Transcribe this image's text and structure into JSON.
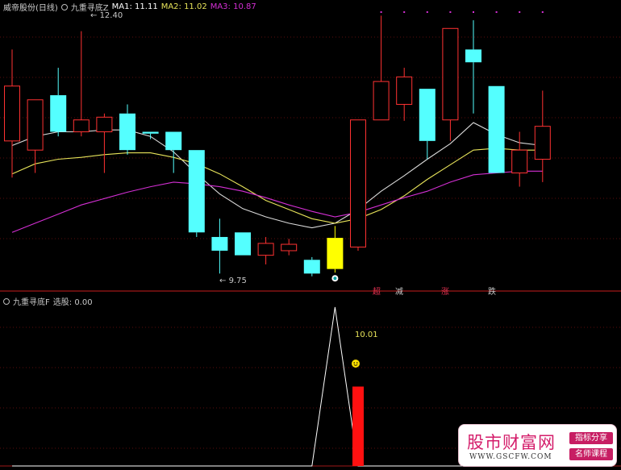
{
  "header_top": {
    "stock_name": "威帝股份(日线)",
    "indicator": "九重寻底Z",
    "ma1": "MA1: 11.11",
    "ma2": "MA2: 11.02",
    "ma3": "MA3: 10.87",
    "colors": {
      "ma1": "#ffffff",
      "ma2": "#e8e45a",
      "ma3": "#d42fd4"
    }
  },
  "header_bottom": {
    "indicator": "九重寻底F",
    "field": "选股: 0.00"
  },
  "annotations": {
    "high_label": "12.40",
    "low_label": "9.75",
    "pct_label": "10.01"
  },
  "signals": [
    {
      "text": "超",
      "color": "#e03050"
    },
    {
      "text": "减",
      "color": "#c8c8c8"
    },
    {
      "text": "涨",
      "color": "#e03050"
    },
    {
      "text": "跌",
      "color": "#c8c8c8"
    }
  ],
  "watermark": {
    "title": "股市财富网",
    "url": "WWW.GSCFW.COM",
    "tag1": "指标分享",
    "tag2": "名师课程"
  },
  "chart_data": {
    "type": "candlestick",
    "up_color": "#ff3232",
    "down_color": "#54ffff",
    "highlight_color": "#ffff00",
    "price_range": [
      9.7,
      12.6
    ],
    "candles": [
      {
        "o": 11.2,
        "h": 12.2,
        "l": 10.8,
        "c": 11.8
      },
      {
        "o": 11.1,
        "h": 11.5,
        "l": 10.85,
        "c": 11.65
      },
      {
        "o": 11.7,
        "h": 12.0,
        "l": 11.25,
        "c": 11.3
      },
      {
        "o": 11.3,
        "h": 12.4,
        "l": 11.25,
        "c": 11.43
      },
      {
        "o": 11.3,
        "h": 11.5,
        "l": 10.85,
        "c": 11.46
      },
      {
        "o": 11.5,
        "h": 11.6,
        "l": 11.05,
        "c": 11.1
      },
      {
        "o": 11.3,
        "h": 11.3,
        "l": 11.22,
        "c": 11.28
      },
      {
        "o": 11.3,
        "h": 11.3,
        "l": 10.85,
        "c": 11.1
      },
      {
        "o": 11.1,
        "h": 11.1,
        "l": 10.15,
        "c": 10.2
      },
      {
        "o": 10.15,
        "h": 10.35,
        "l": 9.75,
        "c": 10.0
      },
      {
        "o": 10.2,
        "h": 10.2,
        "l": 9.95,
        "c": 9.95
      },
      {
        "o": 9.95,
        "h": 10.15,
        "l": 9.85,
        "c": 10.08
      },
      {
        "o": 10.0,
        "h": 10.13,
        "l": 9.95,
        "c": 10.07
      },
      {
        "o": 9.9,
        "h": 9.93,
        "l": 9.72,
        "c": 9.75
      },
      {
        "o": 9.8,
        "h": 10.27,
        "l": 9.76,
        "c": 10.14,
        "highlight": true
      },
      {
        "o": 10.04,
        "h": 11.43,
        "l": 10.0,
        "c": 11.43
      },
      {
        "o": 11.43,
        "h": 12.57,
        "l": 11.43,
        "c": 11.85
      },
      {
        "o": 11.6,
        "h": 12.0,
        "l": 11.42,
        "c": 11.9
      },
      {
        "o": 11.77,
        "h": 11.77,
        "l": 11.0,
        "c": 11.2
      },
      {
        "o": 11.43,
        "h": 12.43,
        "l": 11.2,
        "c": 12.43
      },
      {
        "o": 12.2,
        "h": 12.52,
        "l": 11.5,
        "c": 12.06
      },
      {
        "o": 11.8,
        "h": 11.8,
        "l": 10.85,
        "c": 10.85
      },
      {
        "o": 10.85,
        "h": 11.3,
        "l": 10.7,
        "c": 11.1
      },
      {
        "o": 11.0,
        "h": 11.75,
        "l": 10.75,
        "c": 11.36
      }
    ],
    "ma1": [
      11.15,
      11.25,
      11.3,
      11.3,
      11.32,
      11.32,
      11.25,
      11.08,
      10.84,
      10.62,
      10.46,
      10.37,
      10.3,
      10.25,
      10.3,
      10.45,
      10.65,
      10.82,
      11.0,
      11.17,
      11.4,
      11.27,
      11.18,
      11.15
    ],
    "ma2": [
      10.84,
      10.95,
      11.0,
      11.02,
      11.05,
      11.07,
      11.07,
      11.02,
      10.95,
      10.84,
      10.7,
      10.55,
      10.45,
      10.35,
      10.3,
      10.35,
      10.45,
      10.6,
      10.78,
      10.94,
      11.1,
      11.12,
      11.1,
      11.1
    ],
    "ma3": [
      10.2,
      10.3,
      10.4,
      10.5,
      10.57,
      10.64,
      10.7,
      10.75,
      10.73,
      10.7,
      10.65,
      10.58,
      10.5,
      10.43,
      10.37,
      10.42,
      10.5,
      10.58,
      10.65,
      10.75,
      10.83,
      10.85,
      10.87,
      10.87
    ],
    "signal_line": [
      0,
      0,
      0,
      0,
      0,
      0,
      0,
      0,
      0,
      0,
      0,
      0,
      0,
      0,
      1,
      0,
      0,
      0,
      0,
      0,
      0,
      0,
      0,
      0
    ],
    "signal_bar": [
      0,
      0,
      0,
      0,
      0,
      0,
      0,
      0,
      0,
      0,
      0,
      0,
      0,
      0,
      0,
      0.5,
      0,
      0,
      0,
      0,
      0,
      0,
      0,
      0
    ]
  }
}
